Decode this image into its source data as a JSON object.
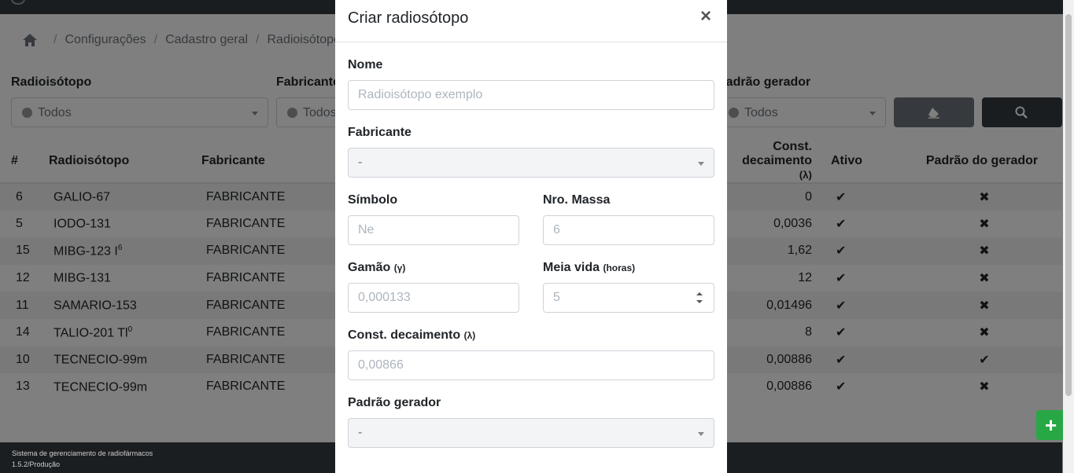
{
  "breadcrumb": [
    "Configurações",
    "Cadastro geral",
    "Radioisótopo"
  ],
  "filters": {
    "radioisotopo": {
      "label": "Radioisótopo",
      "value": "Todos"
    },
    "fabricante": {
      "label": "Fabricante",
      "value": "Todos"
    },
    "padrao_gerador": {
      "label": "Padrão gerador",
      "value": "Todos"
    }
  },
  "table": {
    "headers": [
      "#",
      "Radioisótopo",
      "Fabricante",
      "Const. decaimento",
      "Ativo",
      "Padrão do gerador"
    ],
    "header_dec_unit": "(λ)",
    "rows": [
      {
        "id": "6",
        "name": "GALIO-67",
        "sup": "",
        "fab": "FABRICANTE",
        "dec": "0",
        "ativo": "✔",
        "padrao": "✖"
      },
      {
        "id": "5",
        "name": "IODO-131",
        "sup": "",
        "fab": "FABRICANTE",
        "dec": "0,0036",
        "ativo": "✔",
        "padrao": "✖"
      },
      {
        "id": "15",
        "name": "MIBG-123 I",
        "sup": "6",
        "fab": "FABRICANTE",
        "dec": "1,62",
        "ativo": "✔",
        "padrao": "✖"
      },
      {
        "id": "12",
        "name": "MIBG-131",
        "sup": "",
        "fab": "FABRICANTE",
        "dec": "12",
        "ativo": "✔",
        "padrao": "✖"
      },
      {
        "id": "11",
        "name": "SAMARIO-153",
        "sup": "",
        "fab": "FABRICANTE",
        "dec": "0,01496",
        "ativo": "✔",
        "padrao": "✖"
      },
      {
        "id": "14",
        "name": "TALIO-201 Tl",
        "sup": "0",
        "fab": "FABRICANTE",
        "dec": "8",
        "ativo": "✔",
        "padrao": "✖"
      },
      {
        "id": "10",
        "name": "TECNECIO-99m",
        "sup": "",
        "fab": "FABRICANTE",
        "dec": "0,00886",
        "ativo": "✔",
        "padrao": "✔"
      },
      {
        "id": "13",
        "name": "TECNECIO-99m",
        "sup": "",
        "fab": "FABRICANTE",
        "dec": "0,00886",
        "ativo": "✔",
        "padrao": "✖"
      }
    ]
  },
  "footer": {
    "line1": "Sistema de gerenciamento de radiofármacos",
    "line2": "1.5.2/Produção"
  },
  "modal": {
    "title": "Criar radiosótopo",
    "close": "×",
    "nome": {
      "label": "Nome",
      "placeholder": "Radioisótopo exemplo"
    },
    "fabricante": {
      "label": "Fabricante",
      "value": "-"
    },
    "simbolo": {
      "label": "Símbolo",
      "placeholder": "Ne"
    },
    "nro_massa": {
      "label": "Nro. Massa",
      "placeholder": "6"
    },
    "gamao": {
      "label": "Gamão",
      "unit": "(γ)",
      "placeholder": "0,000133"
    },
    "meia_vida": {
      "label": "Meia vida",
      "unit": "(horas)",
      "placeholder": "5"
    },
    "const_decaimento": {
      "label": "Const. decaimento",
      "unit": "(λ)",
      "placeholder": "0,00866"
    },
    "padrao_gerador": {
      "label": "Padrão gerador",
      "value": "-"
    }
  }
}
